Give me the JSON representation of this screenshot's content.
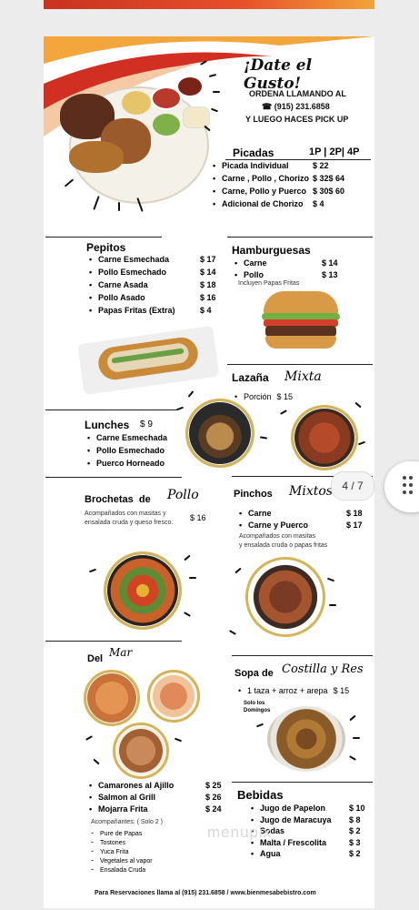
{
  "header": {
    "title": "¡Date el Gusto!",
    "order_line1": "ORDENA LLAMANDO AL",
    "phone": "(915) 231.6858",
    "order_line3": "Y LUEGO HACES PICK UP"
  },
  "picadas": {
    "title": "Picadas",
    "cols": "1P | 2P| 4P",
    "items": [
      {
        "name": "Picada Individual",
        "price": "$ 22"
      },
      {
        "name": "Carne , Pollo , Chorizo",
        "price": "$ 32$ 64"
      },
      {
        "name": "Carne, Pollo y Puerco",
        "price": "$ 30$ 60"
      },
      {
        "name": "Adicional de Chorizo",
        "price": "$ 4"
      }
    ]
  },
  "pepitos": {
    "title": "Pepitos",
    "items": [
      {
        "name": "Carne Esmechada",
        "price": "$ 17"
      },
      {
        "name": "Pollo Esmechado",
        "price": "$ 14"
      },
      {
        "name": "Carne Asada",
        "price": "$ 18"
      },
      {
        "name": "Pollo Asado",
        "price": "$ 16"
      },
      {
        "name": "Papas Fritas (Extra)",
        "price": "$ 4"
      }
    ]
  },
  "hamburguesas": {
    "title": "Hamburguesas",
    "items": [
      {
        "name": "Carne",
        "price": "$ 14"
      },
      {
        "name": "Pollo",
        "price": "$ 13"
      }
    ],
    "note": "Incluyen Papas Fritas"
  },
  "lazana": {
    "title": "Lazaña",
    "script": "Mixta",
    "line": "Porción",
    "price": "$ 15"
  },
  "lunches": {
    "title": "Lunches",
    "price": "$ 9",
    "items": [
      "Carne Esmechada",
      "Pollo Esmechado",
      "Puerco Horneado"
    ]
  },
  "brochetas": {
    "title": "Brochetas  de",
    "script": "Pollo",
    "price": "$ 16",
    "note1": "Acompañados con masitas y",
    "note2": "ensalada cruda y queso fresco."
  },
  "pinchos": {
    "title": "Pinchos",
    "script": "Mixtos",
    "items": [
      {
        "name": "Carne",
        "price": "$ 18"
      },
      {
        "name": "Carne y Puerco",
        "price": "$ 17"
      }
    ],
    "note1": "Acompañados con masitas",
    "note2": "y ensalada cruda o papas fritas"
  },
  "delmar": {
    "title": "Del",
    "script": "Mar",
    "items": [
      {
        "name": "Camarones al Ajillo",
        "price": "$ 25"
      },
      {
        "name": "Salmon al Grill",
        "price": "$ 26"
      },
      {
        "name": "Mojarra Frita",
        "price": "$ 24"
      }
    ],
    "sides_title": "Acompañantes: ( Solo 2 )",
    "sides": [
      "Pure de Papas",
      "Tostones",
      "Yuca Frita",
      "Vegetales al vapor",
      "Ensalada Cruda"
    ]
  },
  "sopa": {
    "title": "Sopa de",
    "script": "Costilla y Res",
    "line": "1 taza + arroz + arepa",
    "price": "$ 15",
    "note1": "Solo los",
    "note2": "Domingos"
  },
  "bebidas": {
    "title": "Bebidas",
    "items": [
      {
        "name": "Jugo de Papelon",
        "price": "$ 10"
      },
      {
        "name": "Jugo de Maracuya",
        "price": "$ 8"
      },
      {
        "name": "Sodas",
        "price": "$ 2"
      },
      {
        "name": "Malta / Frescolita",
        "price": "$ 3"
      },
      {
        "name": "Agua",
        "price": "$ 2"
      }
    ]
  },
  "footer": "Para Reservaciones llama al (915) 231.6858 / www.bienmesabebistro.com",
  "pager": "4 / 7",
  "watermark": "menupix",
  "colors": {
    "accent_red": "#c8331f",
    "accent_orange": "#f2a33a",
    "gold": "#d4b45a"
  }
}
